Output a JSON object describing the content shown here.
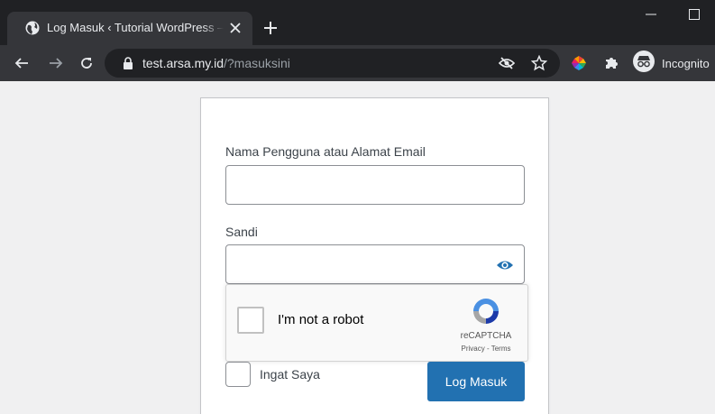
{
  "browser": {
    "tab": {
      "title": "Log Masuk ‹ Tutorial WordPress — WordPress",
      "favicon": "globe-icon"
    },
    "new_tab_icon": "plus-icon",
    "window_controls": [
      "minimize-icon",
      "maximize-icon"
    ],
    "toolbar": {
      "url_host": "test.arsa.my.id",
      "url_path": "/?masuksini",
      "incognito_label": "Incognito",
      "icons": [
        "back-arrow-icon",
        "forward-arrow-icon",
        "reload-icon",
        "lock-icon",
        "eye-off-icon",
        "star-icon",
        "color-extension-icon",
        "puzzle-icon",
        "incognito-icon"
      ]
    }
  },
  "login": {
    "username_label": "Nama Pengguna atau Alamat Email",
    "username_value": "",
    "password_label": "Sandi",
    "password_value": "",
    "recaptcha": {
      "label": "I'm not a robot",
      "brand": "reCAPTCHA",
      "terms": "Privacy - Terms"
    },
    "remember_label": "Ingat Saya",
    "submit_label": "Log Masuk"
  },
  "colors": {
    "primary": "#2271b1",
    "chrome_dark": "#202124",
    "chrome_tab": "#35363a",
    "page_bg": "#f0f0f1"
  }
}
